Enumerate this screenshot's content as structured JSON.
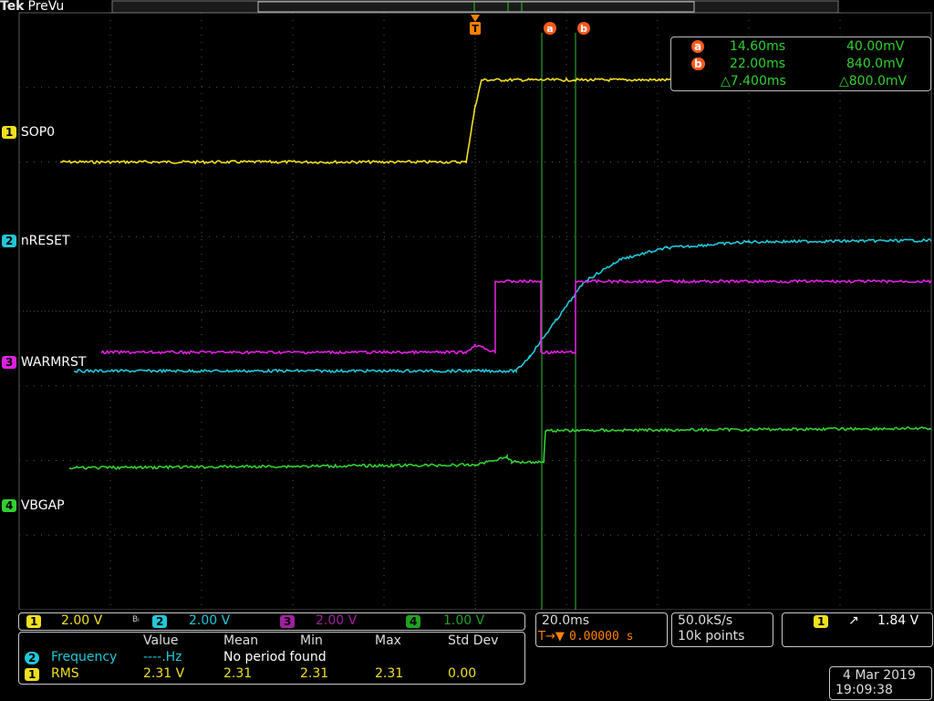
{
  "header": {
    "brand": "Tek",
    "mode": "PreVu"
  },
  "colors": {
    "ch1": "#f0e020",
    "ch2": "#20c8d8",
    "ch3": "#e020e0",
    "ch4": "#30d030",
    "cursor": "#30c030",
    "accent": "#ff8000"
  },
  "channels": [
    {
      "num": "1",
      "name": "SOP0",
      "scale": "2.00 V"
    },
    {
      "num": "2",
      "name": "nRESET",
      "scale": "2.00 V"
    },
    {
      "num": "3",
      "name": "WARMRST",
      "scale": "2.00 V"
    },
    {
      "num": "4",
      "name": "VBGAP",
      "scale": "1.00 V"
    }
  ],
  "bw_indicator": "Bₗ",
  "trigger_marker": "T",
  "cursor_readout": {
    "a_label": "a",
    "a_time": "14.60ms",
    "a_volt": "40.00mV",
    "b_label": "b",
    "b_time": "22.00ms",
    "b_volt": "840.0mV",
    "delta_time": "△7.400ms",
    "delta_volt": "△800.0mV"
  },
  "timebase": {
    "scale": "20.0ms",
    "position": "0.00000 s",
    "position_icon": "T→▼"
  },
  "acquisition": {
    "rate": "50.0kS/s",
    "points": "10k points"
  },
  "trigger": {
    "channel": "1",
    "slope": "↗",
    "level": "1.84 V"
  },
  "measurements": {
    "headers": [
      "Value",
      "Mean",
      "Min",
      "Max",
      "Std Dev"
    ],
    "rows": [
      {
        "ch": "2",
        "name": "Frequency",
        "value": "----.Hz",
        "mean": "No period found",
        "min": "",
        "max": "",
        "std": ""
      },
      {
        "ch": "1",
        "name": "RMS",
        "value": "2.31 V",
        "mean": "2.31",
        "min": "2.31",
        "max": "2.31",
        "std": "0.00"
      }
    ]
  },
  "datetime": {
    "date": "4 Mar  2019",
    "time": "19:09:38"
  },
  "chart_data": {
    "type": "line",
    "x_unit": "div",
    "y_unit": "div",
    "xlim": [
      -5,
      5
    ],
    "ylim": [
      -4,
      4
    ],
    "grid": true,
    "series": [
      {
        "name": "SOP0",
        "channel": 1,
        "x": [
          -4.55,
          -0.1,
          0.0,
          0.07,
          1.0,
          5.0
        ],
        "y": [
          2.0,
          2.0,
          2.75,
          3.1,
          3.1,
          3.1
        ]
      },
      {
        "name": "nRESET",
        "channel": 2,
        "x": [
          -4.4,
          0.45,
          0.6,
          0.9,
          1.2,
          1.6,
          2.1,
          3.0,
          5.0
        ],
        "y": [
          -0.8,
          -0.8,
          -0.6,
          -0.1,
          0.4,
          0.7,
          0.85,
          0.93,
          0.95
        ]
      },
      {
        "name": "WARMRST",
        "channel": 3,
        "x": [
          -4.1,
          -0.1,
          0.0,
          0.22,
          0.22,
          0.72,
          0.72,
          1.1,
          1.1,
          5.0
        ],
        "y": [
          -0.55,
          -0.55,
          -0.45,
          -0.55,
          0.4,
          0.4,
          -0.55,
          -0.55,
          0.4,
          0.4
        ]
      },
      {
        "name": "VBGAP",
        "channel": 4,
        "x": [
          -4.45,
          0.0,
          0.35,
          0.4,
          0.75,
          0.77,
          5.0
        ],
        "y": [
          -2.1,
          -2.06,
          -1.95,
          -2.02,
          -2.02,
          -1.6,
          -1.57
        ]
      }
    ],
    "cursors": [
      {
        "label": "a",
        "x_ms": 14.6
      },
      {
        "label": "b",
        "x_ms": 22.0
      }
    ],
    "trigger_time_ms": 0
  }
}
